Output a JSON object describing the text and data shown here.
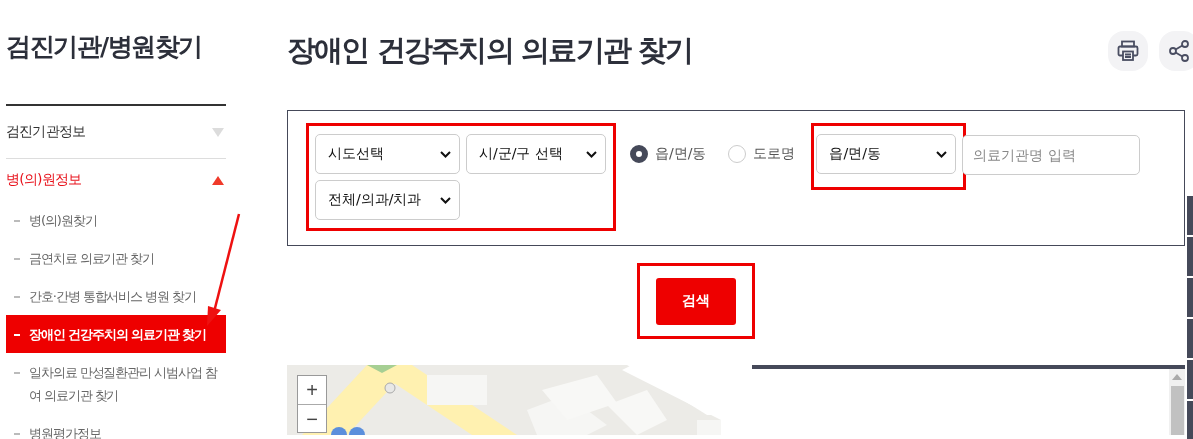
{
  "sidebar": {
    "title": "검진기관/병원찾기",
    "groups": [
      {
        "label": "검진기관정보",
        "expanded": false
      },
      {
        "label": "병(의)원정보",
        "expanded": true,
        "children": [
          {
            "label": "병(의)원찾기",
            "selected": false
          },
          {
            "label": "금연치료 의료기관 찾기",
            "selected": false
          },
          {
            "label": "간호·간병 통합서비스 병원 찾기",
            "selected": false
          },
          {
            "label": "장애인 건강주치의 의료기관 찾기",
            "selected": true
          },
          {
            "label": "일차의료 만성질환관리 시범사업 참여 의료기관 찾기",
            "selected": false
          },
          {
            "label": "병원평가정보",
            "selected": false
          }
        ]
      }
    ]
  },
  "page": {
    "title": "장애인 건강주치의 의료기관 찾기"
  },
  "search": {
    "region_selects": [
      "시도선택",
      "시/군/구 선택",
      "전체/의과/치과"
    ],
    "address_types": [
      {
        "label": "읍/면/동",
        "selected": true
      },
      {
        "label": "도로명",
        "selected": false
      }
    ],
    "dong_select": "읍/면/동",
    "name_field": {
      "placeholder": "의료기관명 입력"
    },
    "button": "검색"
  },
  "map": {
    "kind": "picture",
    "zoom_in": "+",
    "zoom_out": "−"
  }
}
